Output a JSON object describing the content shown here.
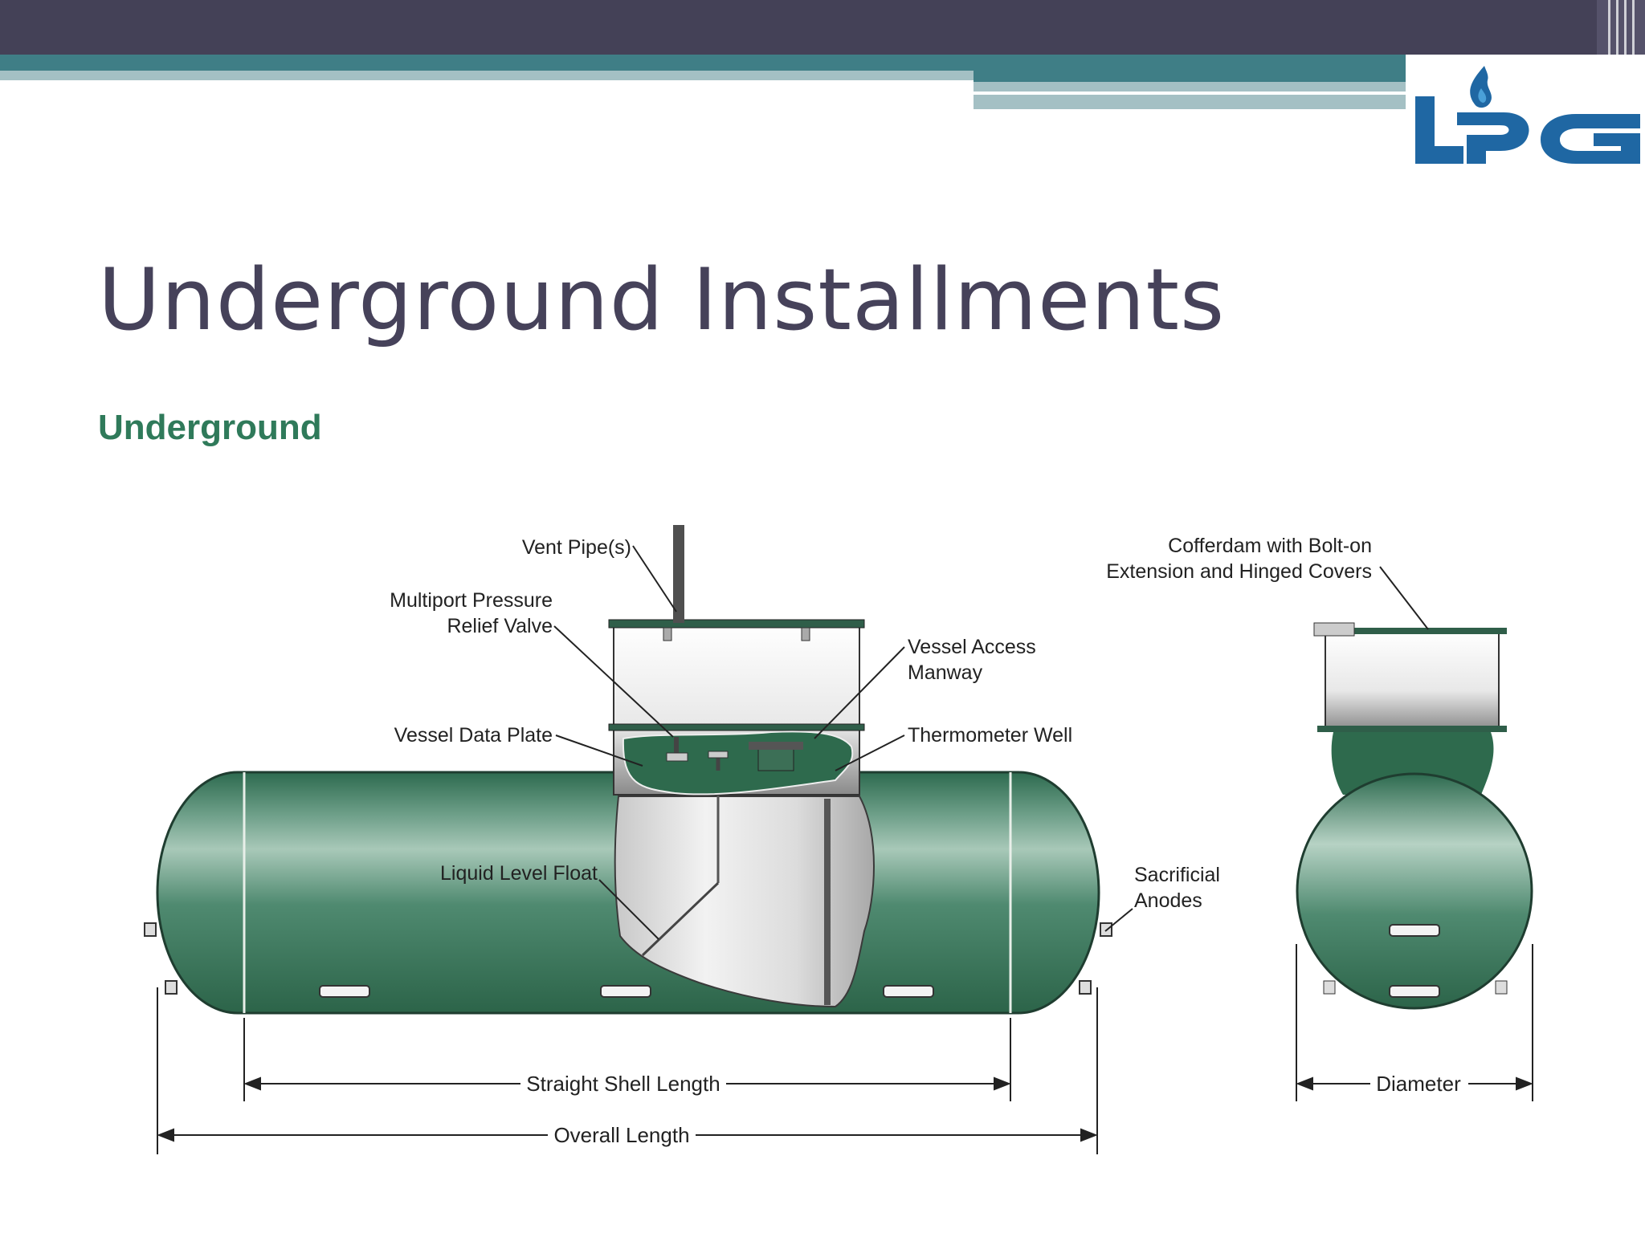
{
  "slide": {
    "title": "Underground Installments",
    "subtitle": "Underground"
  },
  "logo": {
    "text": "LPG",
    "icon": "flame-icon"
  },
  "diagram": {
    "labels": {
      "vent_pipe": "Vent Pipe(s)",
      "relief_valve_line1": "Multiport Pressure",
      "relief_valve_line2": "Relief Valve",
      "data_plate": "Vessel Data Plate",
      "manway_line1": "Vessel Access",
      "manway_line2": "Manway",
      "thermometer": "Thermometer Well",
      "float": "Liquid Level Float",
      "anodes_line1": "Sacrificial",
      "anodes_line2": "Anodes",
      "cofferdam_line1": "Cofferdam with Bolt-on",
      "cofferdam_line2": "Extension and Hinged Covers"
    },
    "dimensions": {
      "straight_shell": "Straight Shell Length",
      "overall": "Overall Length",
      "diameter": "Diameter"
    }
  },
  "colors": {
    "header_bar": "#444157",
    "accent_teal": "#3f7e86",
    "tank_green": "#3f7a5e",
    "subtitle_green": "#2f7a5a",
    "logo_blue": "#1f67a3"
  }
}
